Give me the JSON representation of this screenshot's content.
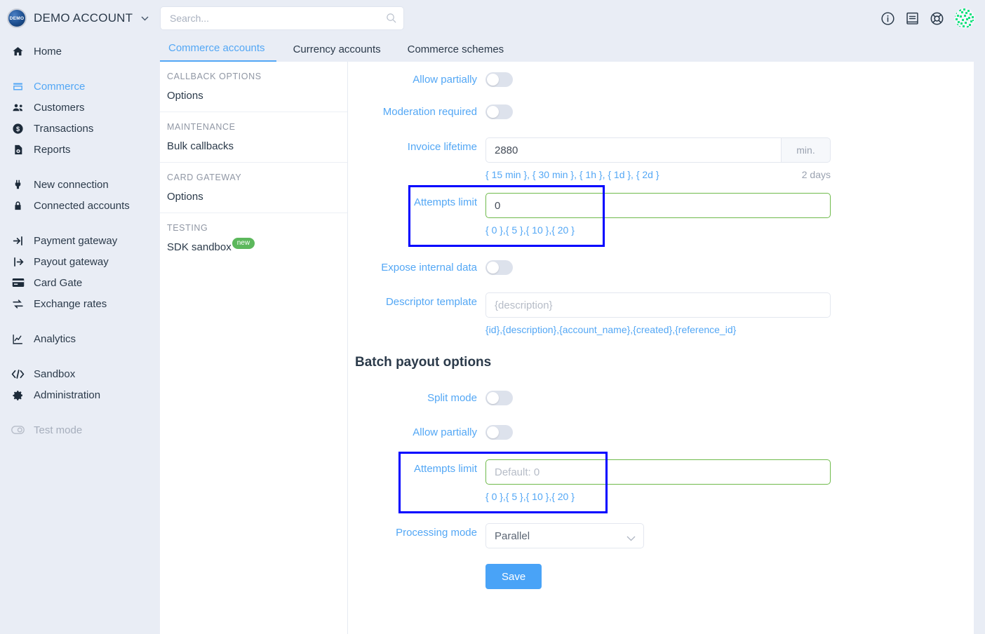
{
  "topbar": {
    "logo_text": "DEMO",
    "account_name": "DEMO ACCOUNT",
    "caret": "⌄",
    "search_placeholder": "Search...",
    "icons": [
      "info-icon",
      "docs-icon",
      "support-icon",
      "avatar"
    ]
  },
  "leftnav": {
    "items": [
      {
        "label": "Home",
        "icon": "home-icon",
        "state": "normal"
      },
      {
        "label": "Commerce",
        "icon": "store-icon",
        "state": "active"
      },
      {
        "label": "Customers",
        "icon": "users-icon",
        "state": "normal"
      },
      {
        "label": "Transactions",
        "icon": "dollar-icon",
        "state": "normal"
      },
      {
        "label": "Reports",
        "icon": "report-icon",
        "state": "normal"
      },
      {
        "label": "New connection",
        "icon": "plug-icon",
        "state": "normal"
      },
      {
        "label": "Connected accounts",
        "icon": "lock-icon",
        "state": "normal"
      },
      {
        "label": "Payment gateway",
        "icon": "signin-icon",
        "state": "normal"
      },
      {
        "label": "Payout gateway",
        "icon": "signout-icon",
        "state": "normal"
      },
      {
        "label": "Card Gate",
        "icon": "card-icon",
        "state": "normal"
      },
      {
        "label": "Exchange rates",
        "icon": "exchange-icon",
        "state": "normal"
      },
      {
        "label": "Analytics",
        "icon": "chart-icon",
        "state": "normal"
      },
      {
        "label": "Sandbox",
        "icon": "code-icon",
        "state": "normal"
      },
      {
        "label": "Administration",
        "icon": "gear-icon",
        "state": "normal"
      },
      {
        "label": "Test mode",
        "icon": "toggle-icon",
        "state": "muted"
      }
    ]
  },
  "tabs": [
    {
      "label": "Commerce accounts",
      "active": true
    },
    {
      "label": "Currency accounts",
      "active": false
    },
    {
      "label": "Commerce schemes",
      "active": false
    }
  ],
  "subbar": {
    "groups": [
      {
        "title": "CALLBACK OPTIONS",
        "links": [
          {
            "label": "Options",
            "badge": ""
          }
        ]
      },
      {
        "title": "MAINTENANCE",
        "links": [
          {
            "label": "Bulk callbacks",
            "badge": ""
          }
        ]
      },
      {
        "title": "CARD GATEWAY",
        "links": [
          {
            "label": "Options",
            "badge": ""
          }
        ]
      },
      {
        "title": "TESTING",
        "links": [
          {
            "label": "SDK sandbox",
            "badge": "new"
          }
        ]
      }
    ]
  },
  "form": {
    "allow_partially_label": "Allow partially",
    "moderation_label": "Moderation required",
    "invoice_lifetime_label": "Invoice lifetime",
    "invoice_lifetime_value": "2880",
    "invoice_lifetime_suffix": "min.",
    "invoice_lifetime_hints": "{ 15 min }, { 30 min }, { 1h }, { 1d }, { 2d }",
    "invoice_lifetime_computed": "2 days",
    "attempts_limit_label": "Attempts limit",
    "attempts_limit_value": "0",
    "attempts_limit_hints": "{ 0 },{ 5 },{ 10 },{ 20 }",
    "expose_internal_label": "Expose internal data",
    "descriptor_label": "Descriptor template",
    "descriptor_placeholder": "{description}",
    "descriptor_hints": "{id},{description},{account_name},{created},{reference_id}"
  },
  "batch": {
    "title": "Batch payout options",
    "split_mode_label": "Split mode",
    "allow_partially_label": "Allow partially",
    "attempts_limit_label": "Attempts limit",
    "attempts_limit_placeholder": "Default: 0",
    "attempts_limit_hints": "{ 0 },{ 5 },{ 10 },{ 20 }",
    "processing_mode_label": "Processing mode",
    "processing_mode_value": "Parallel",
    "save_label": "Save"
  },
  "colors": {
    "accent_blue": "#53a7f5",
    "highlight_box": "#0000ff",
    "focus_green": "#6fba4b",
    "badge_green": "#5cb85c",
    "save_button": "#49a3f7",
    "page_bg": "#e9edf5"
  }
}
